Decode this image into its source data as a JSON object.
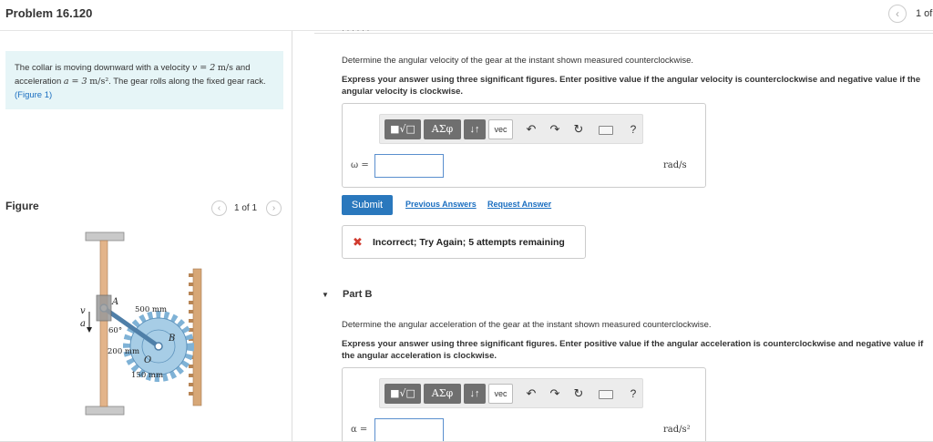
{
  "header": {
    "title": "Problem 16.120",
    "page_count": "1 of"
  },
  "problem": {
    "text_prefix": "The collar is moving downward with a velocity ",
    "velocity_expr": "v = 2",
    "velocity_unit": "m/s",
    "text_and_accel": " and acceleration ",
    "accel_expr": "a = 3",
    "accel_unit": "m/s²",
    "text_suffix": ". The gear rolls along the fixed gear rack.",
    "figure_link": "(Figure 1)"
  },
  "figure": {
    "label": "Figure",
    "count": "1 of 1",
    "annotations": {
      "v": "v",
      "a": "a",
      "A": "A",
      "O": "O",
      "B": "B",
      "angle": "60°",
      "dim_500": "500 mm",
      "dim_200": "200 mm",
      "dim_150": "150 mm"
    }
  },
  "prev_part_stub": "· · · · · ·",
  "part_a": {
    "prompt": "Determine the angular velocity of the gear at the instant shown measured counterclockwise.",
    "instruction": "Express your answer using three significant figures. Enter positive value if the angular velocity is counterclockwise and negative value if the angular velocity is clockwise.",
    "variable": "ω =",
    "unit": "rad/s",
    "input_value": "",
    "toolbar": {
      "templates": "■√□",
      "symbols": "ΑΣφ",
      "updown": "↓↑",
      "vec": "vec",
      "undo": "↶",
      "redo": "↷",
      "reset": "↻",
      "help": "?"
    },
    "submit_label": "Submit",
    "previous_answers": "Previous Answers",
    "request_answer": "Request Answer",
    "feedback_icon": "✖",
    "feedback": "Incorrect; Try Again; 5 attempts remaining"
  },
  "part_b": {
    "arrow": "▼",
    "title": "Part B",
    "prompt": "Determine the angular acceleration of the gear at the instant shown measured counterclockwise.",
    "instruction": "Express your answer using three significant figures. Enter positive value if the angular acceleration is counterclockwise and negative value if the angular acceleration is clockwise.",
    "variable": "α =",
    "unit": "rad/s²",
    "input_value": "",
    "toolbar": {
      "templates": "■√□",
      "symbols": "ΑΣφ",
      "updown": "↓↑",
      "vec": "vec",
      "undo": "↶",
      "redo": "↷",
      "reset": "↻",
      "help": "?"
    }
  },
  "colors": {
    "accent": "#2a78bd",
    "link": "#1a6ec0",
    "problem_bg": "#e6f5f7",
    "error": "#d13b2f",
    "gear": "#7fb2d6"
  }
}
